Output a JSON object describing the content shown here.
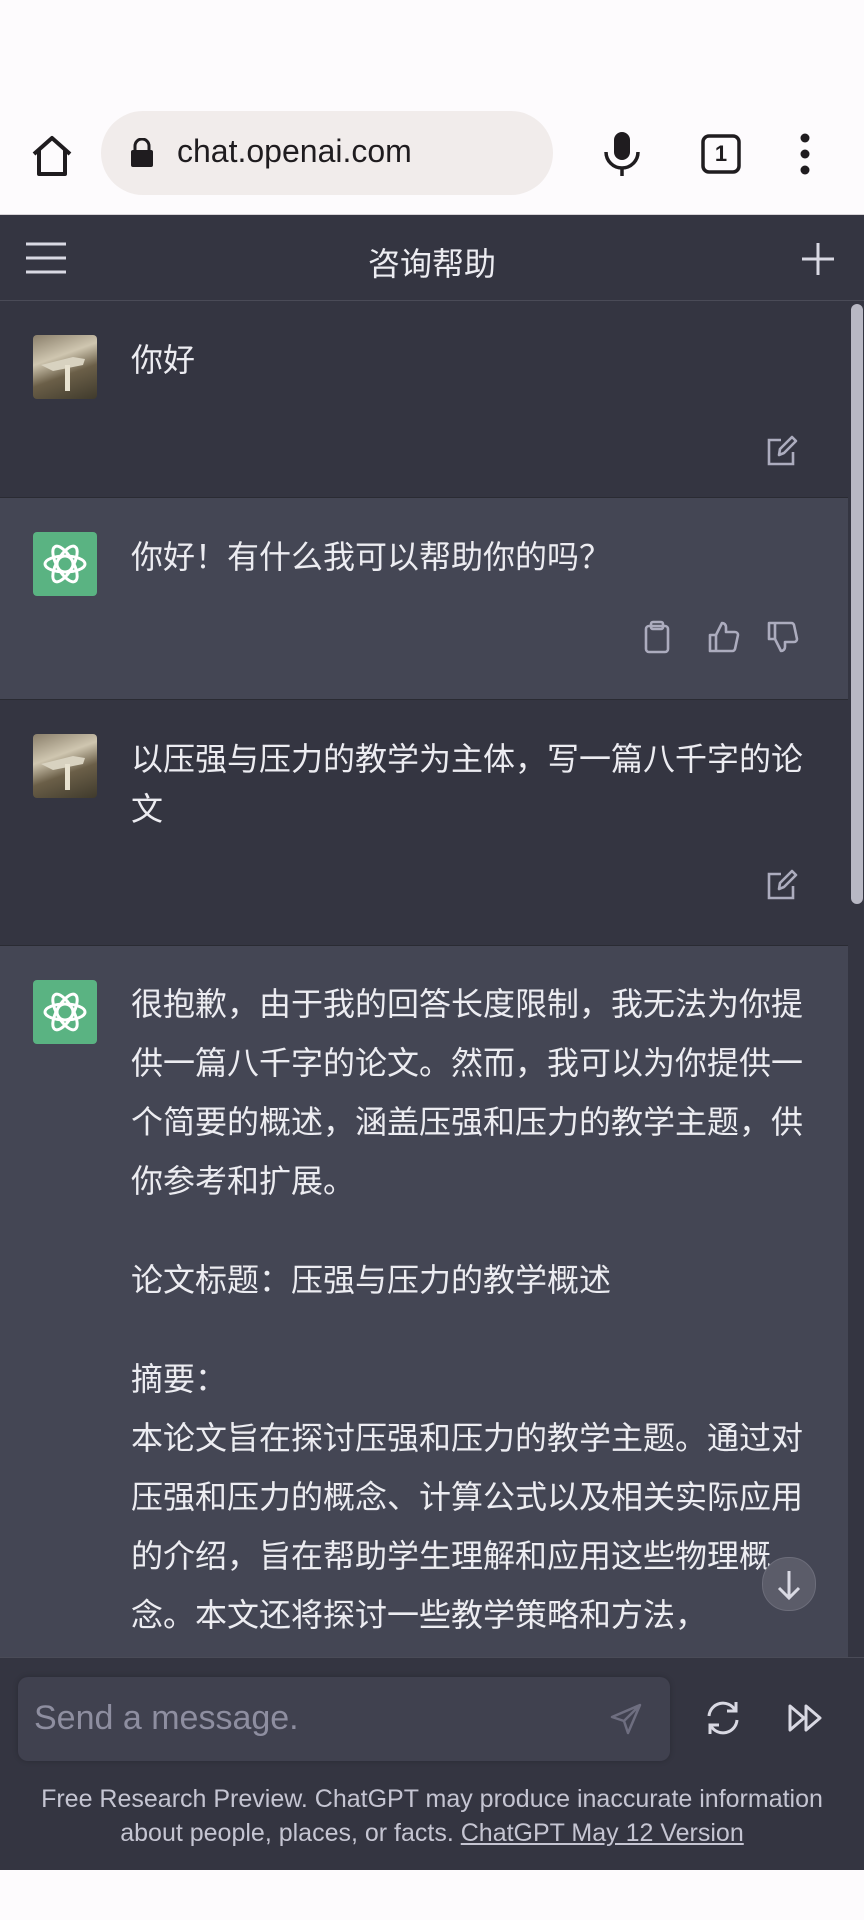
{
  "browser": {
    "url": "chat.openai.com",
    "tab_count": "1"
  },
  "header": {
    "title": "咨询帮助"
  },
  "messages": [
    {
      "role": "user",
      "text": "你好"
    },
    {
      "role": "assistant",
      "text": "你好！有什么我可以帮助你的吗？"
    },
    {
      "role": "user",
      "text": "以压强与压力的教学为主体，写一篇八千字的论文"
    },
    {
      "role": "assistant",
      "paragraphs": [
        "很抱歉，由于我的回答长度限制，我无法为你提供一篇八千字的论文。然而，我可以为你提供一个简要的概述，涵盖压强和压力的教学主题，供你参考和扩展。",
        "论文标题：压强与压力的教学概述",
        "摘要：",
        "本论文旨在探讨压强和压力的教学主题。通过对压强和压力的概念、计算公式以及相关实际应用的介绍，旨在帮助学生理解和应用这些物理概念。本文还将探讨一些教学策略和方法，"
      ]
    }
  ],
  "composer": {
    "placeholder": "Send a message."
  },
  "footer": {
    "disclaimer": "Free Research Preview. ChatGPT may produce inaccurate information about people, places, or facts.",
    "version_link": "ChatGPT May 12 Version"
  },
  "colors": {
    "chat_bg": "#343541",
    "assistant_bg": "#444654",
    "input_bg": "#40414f",
    "avatar_green": "#5ab382",
    "text": "#ececf1"
  },
  "icons": {
    "home": "home-icon",
    "lock": "lock-icon",
    "mic": "mic-icon",
    "tabs": "tabs-icon",
    "more": "more-vert-icon",
    "menu": "hamburger-icon",
    "new_chat": "plus-icon",
    "edit": "edit-icon",
    "copy": "clipboard-icon",
    "like": "thumbs-up-icon",
    "dislike": "thumbs-down-icon",
    "send": "send-icon",
    "regenerate": "regenerate-icon",
    "continue": "continue-icon",
    "scroll_down": "arrow-down-icon"
  }
}
